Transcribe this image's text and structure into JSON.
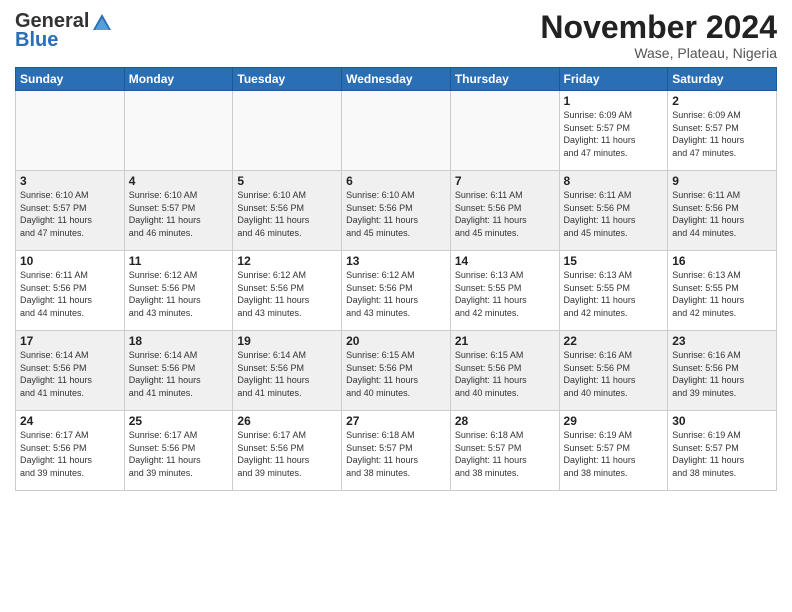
{
  "header": {
    "logo_general": "General",
    "logo_blue": "Blue",
    "month": "November 2024",
    "location": "Wase, Plateau, Nigeria"
  },
  "weekdays": [
    "Sunday",
    "Monday",
    "Tuesday",
    "Wednesday",
    "Thursday",
    "Friday",
    "Saturday"
  ],
  "weeks": [
    [
      {
        "day": "",
        "info": ""
      },
      {
        "day": "",
        "info": ""
      },
      {
        "day": "",
        "info": ""
      },
      {
        "day": "",
        "info": ""
      },
      {
        "day": "",
        "info": ""
      },
      {
        "day": "1",
        "info": "Sunrise: 6:09 AM\nSunset: 5:57 PM\nDaylight: 11 hours\nand 47 minutes."
      },
      {
        "day": "2",
        "info": "Sunrise: 6:09 AM\nSunset: 5:57 PM\nDaylight: 11 hours\nand 47 minutes."
      }
    ],
    [
      {
        "day": "3",
        "info": "Sunrise: 6:10 AM\nSunset: 5:57 PM\nDaylight: 11 hours\nand 47 minutes."
      },
      {
        "day": "4",
        "info": "Sunrise: 6:10 AM\nSunset: 5:57 PM\nDaylight: 11 hours\nand 46 minutes."
      },
      {
        "day": "5",
        "info": "Sunrise: 6:10 AM\nSunset: 5:56 PM\nDaylight: 11 hours\nand 46 minutes."
      },
      {
        "day": "6",
        "info": "Sunrise: 6:10 AM\nSunset: 5:56 PM\nDaylight: 11 hours\nand 45 minutes."
      },
      {
        "day": "7",
        "info": "Sunrise: 6:11 AM\nSunset: 5:56 PM\nDaylight: 11 hours\nand 45 minutes."
      },
      {
        "day": "8",
        "info": "Sunrise: 6:11 AM\nSunset: 5:56 PM\nDaylight: 11 hours\nand 45 minutes."
      },
      {
        "day": "9",
        "info": "Sunrise: 6:11 AM\nSunset: 5:56 PM\nDaylight: 11 hours\nand 44 minutes."
      }
    ],
    [
      {
        "day": "10",
        "info": "Sunrise: 6:11 AM\nSunset: 5:56 PM\nDaylight: 11 hours\nand 44 minutes."
      },
      {
        "day": "11",
        "info": "Sunrise: 6:12 AM\nSunset: 5:56 PM\nDaylight: 11 hours\nand 43 minutes."
      },
      {
        "day": "12",
        "info": "Sunrise: 6:12 AM\nSunset: 5:56 PM\nDaylight: 11 hours\nand 43 minutes."
      },
      {
        "day": "13",
        "info": "Sunrise: 6:12 AM\nSunset: 5:56 PM\nDaylight: 11 hours\nand 43 minutes."
      },
      {
        "day": "14",
        "info": "Sunrise: 6:13 AM\nSunset: 5:55 PM\nDaylight: 11 hours\nand 42 minutes."
      },
      {
        "day": "15",
        "info": "Sunrise: 6:13 AM\nSunset: 5:55 PM\nDaylight: 11 hours\nand 42 minutes."
      },
      {
        "day": "16",
        "info": "Sunrise: 6:13 AM\nSunset: 5:55 PM\nDaylight: 11 hours\nand 42 minutes."
      }
    ],
    [
      {
        "day": "17",
        "info": "Sunrise: 6:14 AM\nSunset: 5:56 PM\nDaylight: 11 hours\nand 41 minutes."
      },
      {
        "day": "18",
        "info": "Sunrise: 6:14 AM\nSunset: 5:56 PM\nDaylight: 11 hours\nand 41 minutes."
      },
      {
        "day": "19",
        "info": "Sunrise: 6:14 AM\nSunset: 5:56 PM\nDaylight: 11 hours\nand 41 minutes."
      },
      {
        "day": "20",
        "info": "Sunrise: 6:15 AM\nSunset: 5:56 PM\nDaylight: 11 hours\nand 40 minutes."
      },
      {
        "day": "21",
        "info": "Sunrise: 6:15 AM\nSunset: 5:56 PM\nDaylight: 11 hours\nand 40 minutes."
      },
      {
        "day": "22",
        "info": "Sunrise: 6:16 AM\nSunset: 5:56 PM\nDaylight: 11 hours\nand 40 minutes."
      },
      {
        "day": "23",
        "info": "Sunrise: 6:16 AM\nSunset: 5:56 PM\nDaylight: 11 hours\nand 39 minutes."
      }
    ],
    [
      {
        "day": "24",
        "info": "Sunrise: 6:17 AM\nSunset: 5:56 PM\nDaylight: 11 hours\nand 39 minutes."
      },
      {
        "day": "25",
        "info": "Sunrise: 6:17 AM\nSunset: 5:56 PM\nDaylight: 11 hours\nand 39 minutes."
      },
      {
        "day": "26",
        "info": "Sunrise: 6:17 AM\nSunset: 5:56 PM\nDaylight: 11 hours\nand 39 minutes."
      },
      {
        "day": "27",
        "info": "Sunrise: 6:18 AM\nSunset: 5:57 PM\nDaylight: 11 hours\nand 38 minutes."
      },
      {
        "day": "28",
        "info": "Sunrise: 6:18 AM\nSunset: 5:57 PM\nDaylight: 11 hours\nand 38 minutes."
      },
      {
        "day": "29",
        "info": "Sunrise: 6:19 AM\nSunset: 5:57 PM\nDaylight: 11 hours\nand 38 minutes."
      },
      {
        "day": "30",
        "info": "Sunrise: 6:19 AM\nSunset: 5:57 PM\nDaylight: 11 hours\nand 38 minutes."
      }
    ]
  ]
}
